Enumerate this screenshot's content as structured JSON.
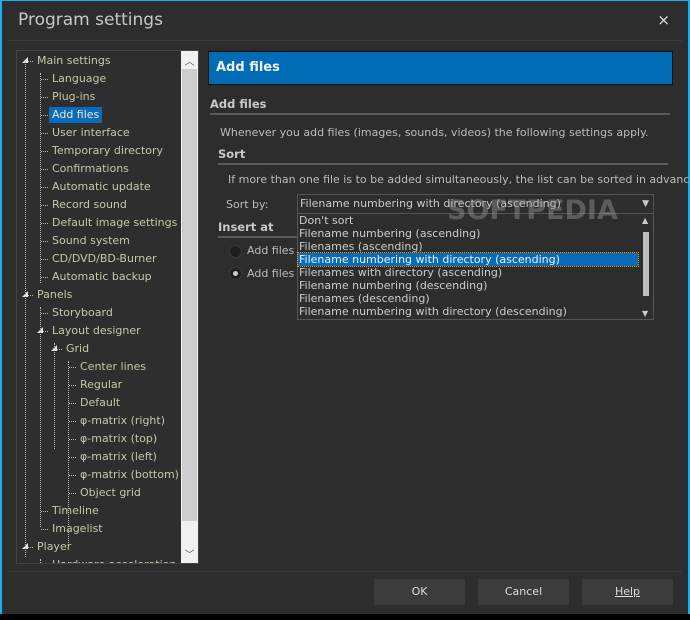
{
  "window": {
    "title": "Program settings",
    "close_icon": "×"
  },
  "tree": {
    "items": [
      {
        "label": "Main settings",
        "level": 0,
        "expanded": true
      },
      {
        "label": "Language",
        "level": 1
      },
      {
        "label": "Plug-ins",
        "level": 1
      },
      {
        "label": "Add files",
        "level": 1,
        "selected": true
      },
      {
        "label": "User interface",
        "level": 1
      },
      {
        "label": "Temporary directory",
        "level": 1
      },
      {
        "label": "Confirmations",
        "level": 1
      },
      {
        "label": "Automatic update",
        "level": 1
      },
      {
        "label": "Record sound",
        "level": 1
      },
      {
        "label": "Default image settings",
        "level": 1
      },
      {
        "label": "Sound system",
        "level": 1
      },
      {
        "label": "CD/DVD/BD-Burner",
        "level": 1
      },
      {
        "label": "Automatic backup",
        "level": 1
      },
      {
        "label": "Panels",
        "level": 0,
        "expanded": true
      },
      {
        "label": "Storyboard",
        "level": 1
      },
      {
        "label": "Layout designer",
        "level": 1,
        "expanded": true
      },
      {
        "label": "Grid",
        "level": 2,
        "expanded": true
      },
      {
        "label": "Center lines",
        "level": 3
      },
      {
        "label": "Regular",
        "level": 3
      },
      {
        "label": "Default",
        "level": 3
      },
      {
        "label": "φ-matrix (right)",
        "level": 3
      },
      {
        "label": "φ-matrix (top)",
        "level": 3
      },
      {
        "label": "φ-matrix (left)",
        "level": 3
      },
      {
        "label": "φ-matrix (bottom)",
        "level": 3
      },
      {
        "label": "Object grid",
        "level": 3
      },
      {
        "label": "Timeline",
        "level": 1
      },
      {
        "label": "Imagelist",
        "level": 1
      },
      {
        "label": "Player",
        "level": 0,
        "expanded": true
      },
      {
        "label": "Hardware acceleration",
        "level": 1
      }
    ]
  },
  "main": {
    "header": "Add files",
    "section_title": "Add files",
    "intro": "Whenever you add files (images, sounds, videos) the following settings apply.",
    "sort": {
      "title": "Sort",
      "desc": "If more than one file is to be added simultaneously, the list can be sorted in advance.",
      "label": "Sort by:",
      "value": "Filename numbering with directory (ascending)",
      "options": [
        "Don't sort",
        "Filename numbering (ascending)",
        "Filenames (ascending)",
        "Filename numbering with directory (ascending)",
        "Filenames with directory (ascending)",
        "Filename numbering (descending)",
        "Filenames (descending)",
        "Filename numbering with directory (descending)"
      ],
      "selected_index": 3
    },
    "insert": {
      "title": "Insert at",
      "options": [
        {
          "label": "Add files a",
          "checked": false
        },
        {
          "label": "Add files a",
          "checked": true
        }
      ]
    }
  },
  "watermark": "SOFTPEDIA",
  "buttons": {
    "ok": "OK",
    "cancel": "Cancel",
    "help": "Help"
  },
  "colors": {
    "accent": "#006cb6",
    "border": "#17b0f0"
  }
}
